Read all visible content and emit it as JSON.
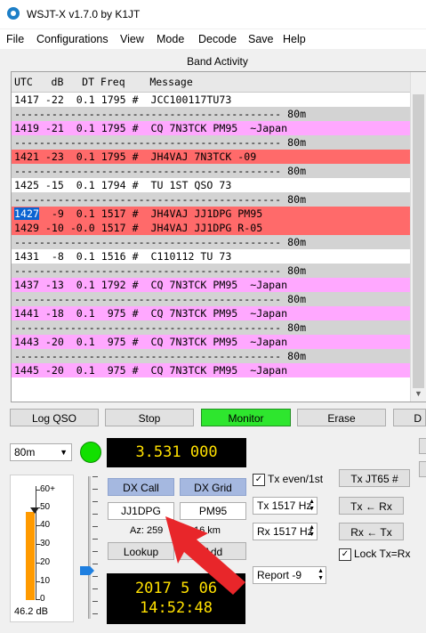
{
  "window": {
    "title": "WSJT-X   v1.7.0   by K1JT"
  },
  "menu": [
    "File",
    "Configurations",
    "View",
    "Mode",
    "Decode",
    "Save",
    "Help"
  ],
  "band_activity": {
    "label": "Band Activity",
    "header": "UTC   dB   DT Freq    Message",
    "rows": [
      {
        "kind": "msg-white",
        "text": "1417 -22  0.1 1795 #  JCC100117TU73"
      },
      {
        "kind": "sep",
        "text": "------------------------------------------- 80m"
      },
      {
        "kind": "msg-pink",
        "text": "1419 -21  0.1 1795 #  CQ 7N3TCK PM95  ~Japan"
      },
      {
        "kind": "sep",
        "text": "------------------------------------------- 80m"
      },
      {
        "kind": "msg-red",
        "text": "1421 -23  0.1 1795 #  JH4VAJ 7N3TCK -09"
      },
      {
        "kind": "sep",
        "text": "------------------------------------------- 80m"
      },
      {
        "kind": "msg-white",
        "text": "1425 -15  0.1 1794 #  TU 1ST QSO 73"
      },
      {
        "kind": "sep",
        "text": "------------------------------------------- 80m"
      },
      {
        "kind": "msg-red",
        "text": "1427  -9  0.1 1517 #  JH4VAJ JJ1DPG PM95",
        "selected": "1427"
      },
      {
        "kind": "msg-red",
        "text": "1429 -10 -0.0 1517 #  JH4VAJ JJ1DPG R-05"
      },
      {
        "kind": "sep",
        "text": "------------------------------------------- 80m"
      },
      {
        "kind": "msg-white",
        "text": "1431  -8  0.1 1516 #  C110112 TU 73"
      },
      {
        "kind": "sep",
        "text": "------------------------------------------- 80m"
      },
      {
        "kind": "msg-pink",
        "text": "1437 -13  0.1 1792 #  CQ 7N3TCK PM95  ~Japan"
      },
      {
        "kind": "sep",
        "text": "------------------------------------------- 80m"
      },
      {
        "kind": "msg-pink",
        "text": "1441 -18  0.1  975 #  CQ 7N3TCK PM95  ~Japan"
      },
      {
        "kind": "sep",
        "text": "------------------------------------------- 80m"
      },
      {
        "kind": "msg-pink",
        "text": "1443 -20  0.1  975 #  CQ 7N3TCK PM95  ~Japan"
      },
      {
        "kind": "sep",
        "text": "------------------------------------------- 80m"
      },
      {
        "kind": "msg-pink",
        "text": "1445 -20  0.1  975 #  CQ 7N3TCK PM95  ~Japan"
      }
    ]
  },
  "buttons": {
    "log_qso": "Log QSO",
    "stop": "Stop",
    "monitor": "Monitor",
    "erase": "Erase",
    "decode_partial": "D"
  },
  "band_select": "80m",
  "dial_frequency": "3.531 000",
  "meter": {
    "labels": [
      "60+",
      "50",
      "40",
      "30",
      "20",
      "10",
      "0"
    ],
    "reading": "46.2 dB"
  },
  "dx": {
    "call_label": "DX Call",
    "grid_label": "DX Grid",
    "call": "JJ1DPG",
    "grid": "PM95",
    "az": "Az: 259",
    "dist": "16 km",
    "lookup": "Lookup",
    "add": "Add"
  },
  "clock": {
    "date": "2017 5 06",
    "time": "14:52:48"
  },
  "tx": {
    "even_first_label": "Tx even/1st",
    "tx_freq": "Tx  1517  Hz",
    "rx_freq": "Rx  1517  Hz",
    "report": "Report -9",
    "tx_jt65": "Tx JT65  #",
    "tx_from_rx": "Tx ← Rx",
    "rx_from_tx": "Rx ← Tx",
    "lock_label": "Lock Tx=Rx"
  },
  "colors": {
    "pink": "#ffa8ff",
    "red": "#ff6a6a",
    "monitor_green": "#2ee62e",
    "display_yellow": "#ffe000",
    "annotation_arrow": "#e8262a"
  }
}
